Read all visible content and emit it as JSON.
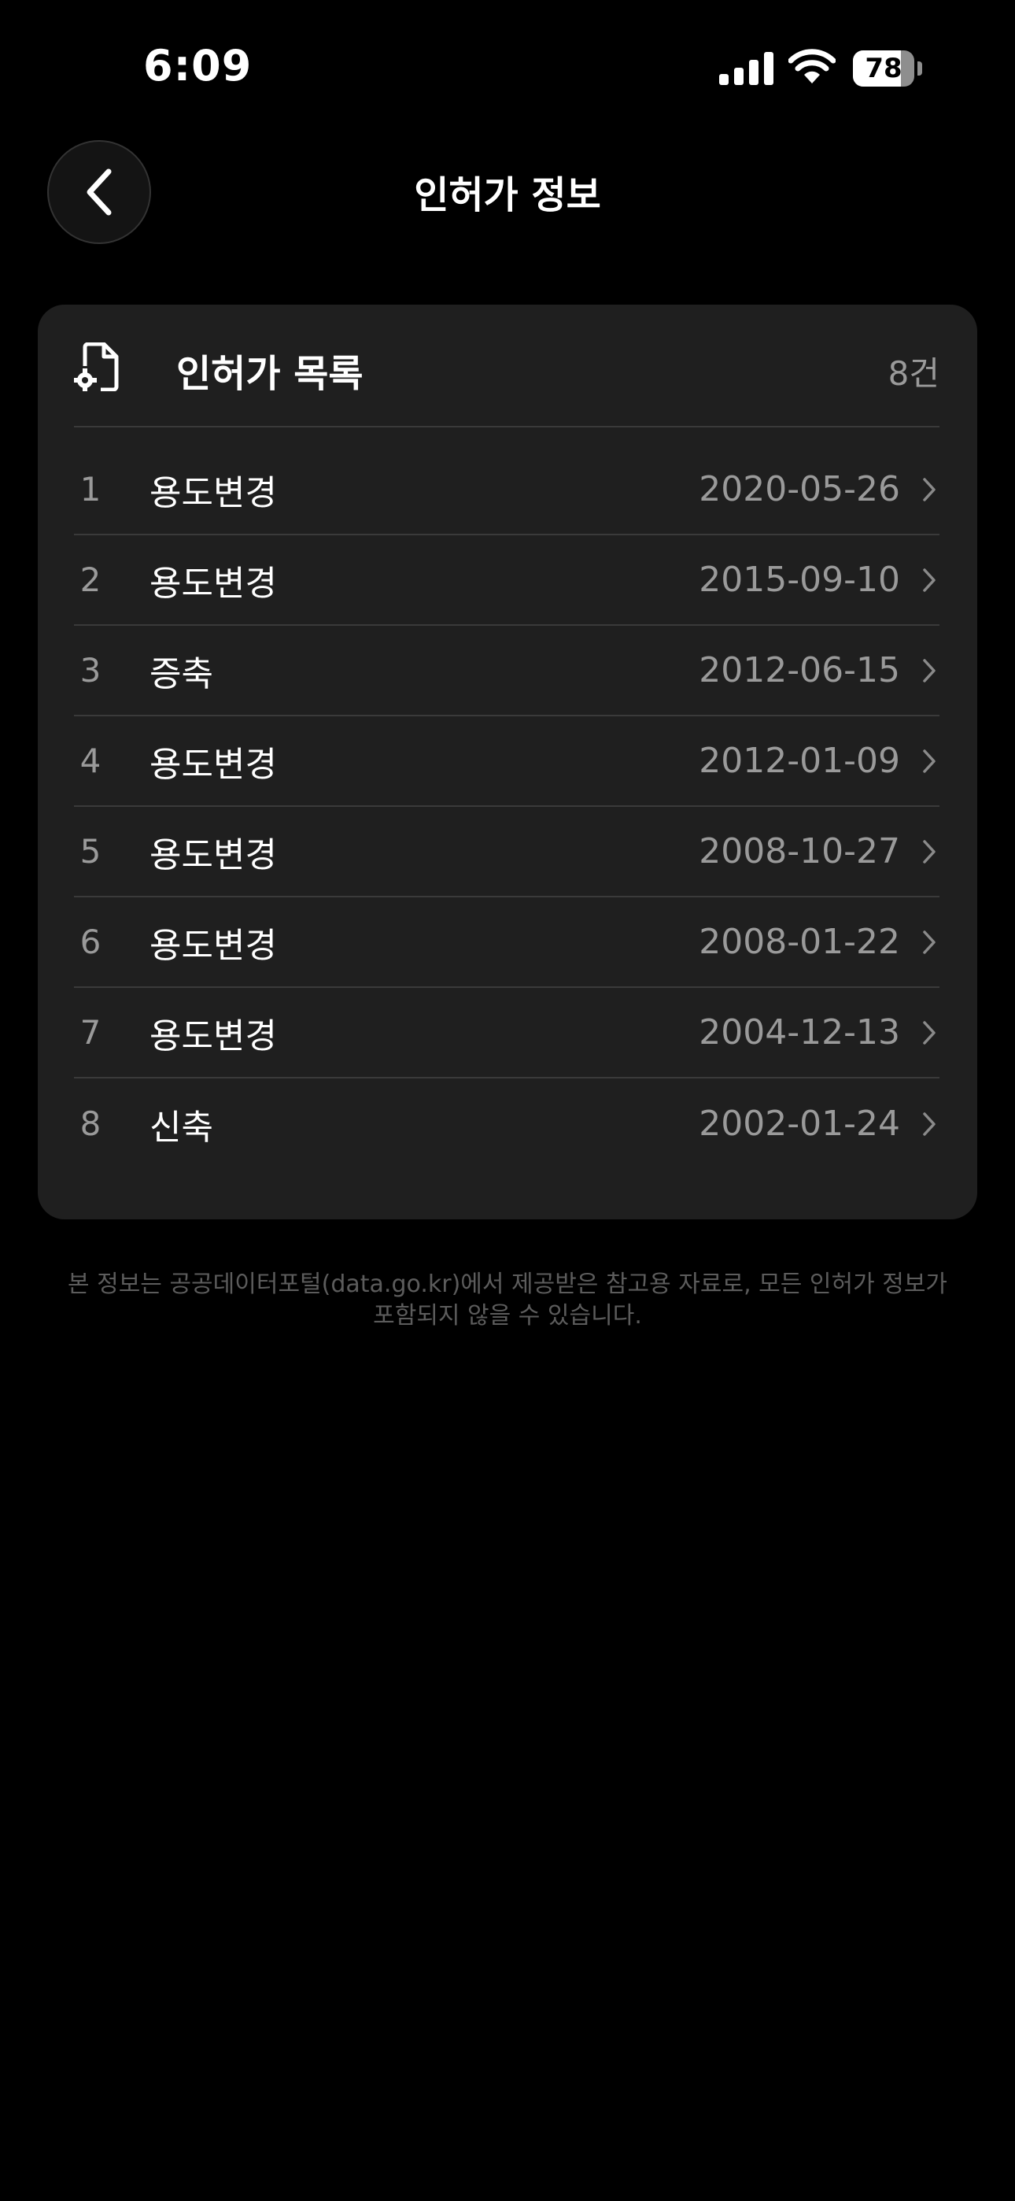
{
  "status_bar": {
    "time": "6:09",
    "battery_percent": 78,
    "battery_label": "78"
  },
  "nav": {
    "title": "인허가 정보",
    "back_icon": "chevron-left-icon"
  },
  "card": {
    "title": "인허가 목록",
    "count": "8건",
    "icon": "document-gear-icon",
    "items": [
      {
        "index": "1",
        "type": "용도변경",
        "date": "2020-05-26"
      },
      {
        "index": "2",
        "type": "용도변경",
        "date": "2015-09-10"
      },
      {
        "index": "3",
        "type": "증축",
        "date": "2012-06-15"
      },
      {
        "index": "4",
        "type": "용도변경",
        "date": "2012-01-09"
      },
      {
        "index": "5",
        "type": "용도변경",
        "date": "2008-10-27"
      },
      {
        "index": "6",
        "type": "용도변경",
        "date": "2008-01-22"
      },
      {
        "index": "7",
        "type": "용도변경",
        "date": "2004-12-13"
      },
      {
        "index": "8",
        "type": "신축",
        "date": "2002-01-24"
      }
    ]
  },
  "disclaimer": {
    "line1": "본 정보는 공공데이터포털(data.go.kr)에서 제공받은 참고용 자료로, 모든 인허가 정보가",
    "line2": "포함되지 않을 수 있습니다."
  },
  "colors": {
    "background": "#000000",
    "card": "#1f1f1f",
    "divider": "#3a3a3a",
    "secondary_text": "#9a9a9a"
  }
}
